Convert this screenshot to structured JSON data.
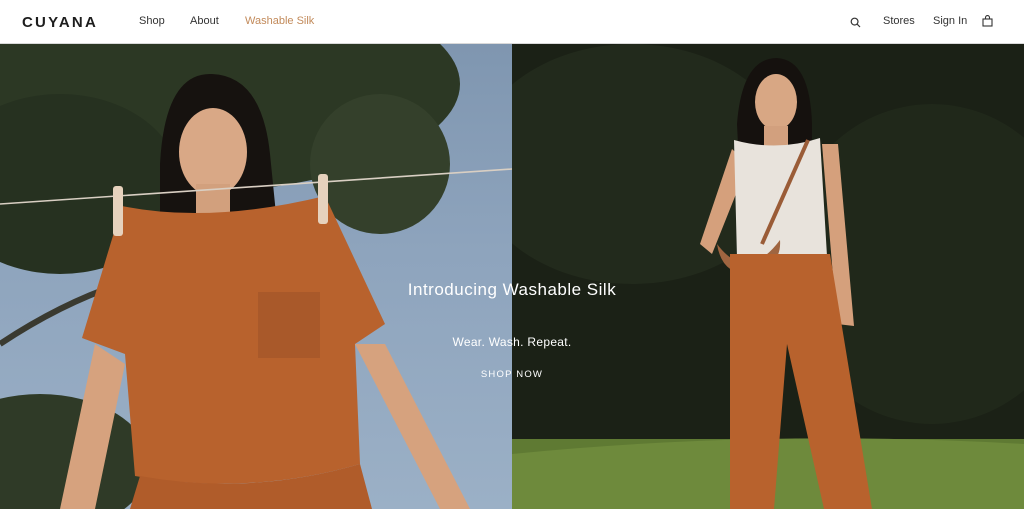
{
  "brand": {
    "logo_text": "CUYANA"
  },
  "nav": {
    "items": [
      {
        "label": "Shop"
      },
      {
        "label": "About"
      },
      {
        "label": "Washable Silk"
      }
    ],
    "right": {
      "search_icon": "search-icon",
      "stores_label": "Stores",
      "signin_label": "Sign In",
      "bag_icon": "shopping-bag-icon"
    }
  },
  "hero": {
    "title": "Introducing Washable Silk",
    "subtitle": "Wear. Wash. Repeat.",
    "cta_label": "SHOP NOW"
  },
  "colors": {
    "accent": "#c28a5a",
    "text_dark": "#1d1d1d",
    "garment_rust": "#b8622d"
  }
}
